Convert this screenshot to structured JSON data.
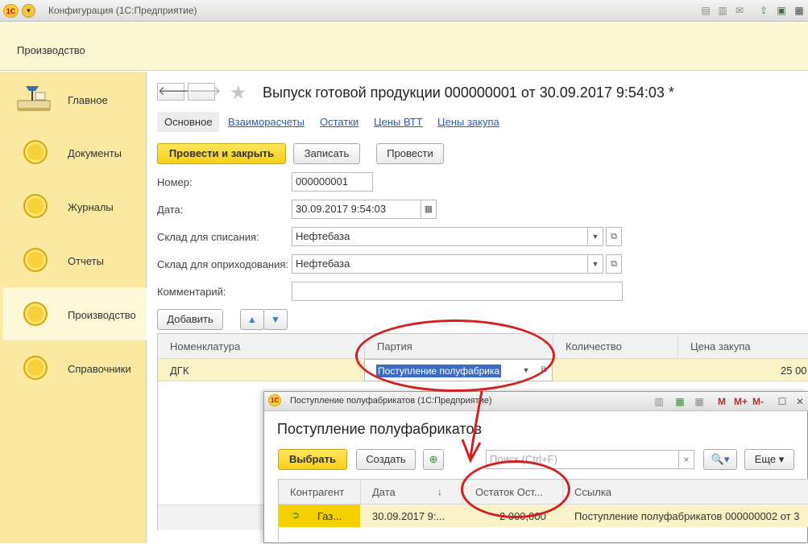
{
  "window": {
    "title": "Конфигурация  (1С:Предприятие)",
    "logo": "1С"
  },
  "section_panel": {
    "title": "Производство"
  },
  "sidebar": {
    "items": [
      {
        "label": "Главное",
        "icon": "desk-lamp-icon"
      },
      {
        "label": "Документы",
        "icon": "coin-icon"
      },
      {
        "label": "Журналы",
        "icon": "coin-icon"
      },
      {
        "label": "Отчеты",
        "icon": "coin-icon"
      },
      {
        "label": "Производство",
        "icon": "coin-icon",
        "active": true
      },
      {
        "label": "Справочники",
        "icon": "coin-icon"
      }
    ]
  },
  "form": {
    "title": "Выпуск готовой продукции 000000001 от 30.09.2017 9:54:03 *",
    "tabs": [
      "Основное",
      "Взаиморасчеты",
      "Остатки",
      "Цены ВТТ",
      "Цены закупа"
    ],
    "buttons": {
      "post_close": "Провести и закрыть",
      "save": "Записать",
      "post": "Провести"
    },
    "fields": {
      "number": {
        "label": "Номер:",
        "value": "000000001"
      },
      "date": {
        "label": "Дата:",
        "value": "30.09.2017  9:54:03"
      },
      "warehouse_out": {
        "label": "Склад для списания:",
        "value": "Нефтебаза"
      },
      "warehouse_in": {
        "label": "Склад для оприходования:",
        "value": "Нефтебаза"
      },
      "comment": {
        "label": "Комментарий:",
        "value": ""
      }
    },
    "table": {
      "add_button": "Добавить",
      "columns": [
        "Номенклатура",
        "Партия",
        "Количество",
        "Цена закупа"
      ],
      "rows": [
        {
          "item": "ДГК",
          "batch": "Поступление полуфабрика",
          "qty": "",
          "price": "25 00"
        }
      ]
    }
  },
  "popup": {
    "window_title": "Поступление полуфабрикатов  (1С:Предприятие)",
    "title": "Поступление полуфабрикатов",
    "toolbar": {
      "select": "Выбрать",
      "create": "Создать",
      "search_placeholder": "Поиск (Ctrl+F)",
      "more": "Еще",
      "m": "M",
      "mplus": "M+",
      "mminus": "M-"
    },
    "columns": [
      "Контрагент",
      "Дата",
      "Остаток Ост...",
      "Ссылка"
    ],
    "rows": [
      {
        "counterparty": "Газ...",
        "date": "30.09.2017 9:...",
        "balance": "2 000,000",
        "ref": "Поступление полуфабрикатов 000000002 от 3"
      }
    ]
  },
  "colors": {
    "accent_yellow": "#f5cf17",
    "sidebar": "#fbe9a2",
    "annotation_red": "#d42020"
  }
}
